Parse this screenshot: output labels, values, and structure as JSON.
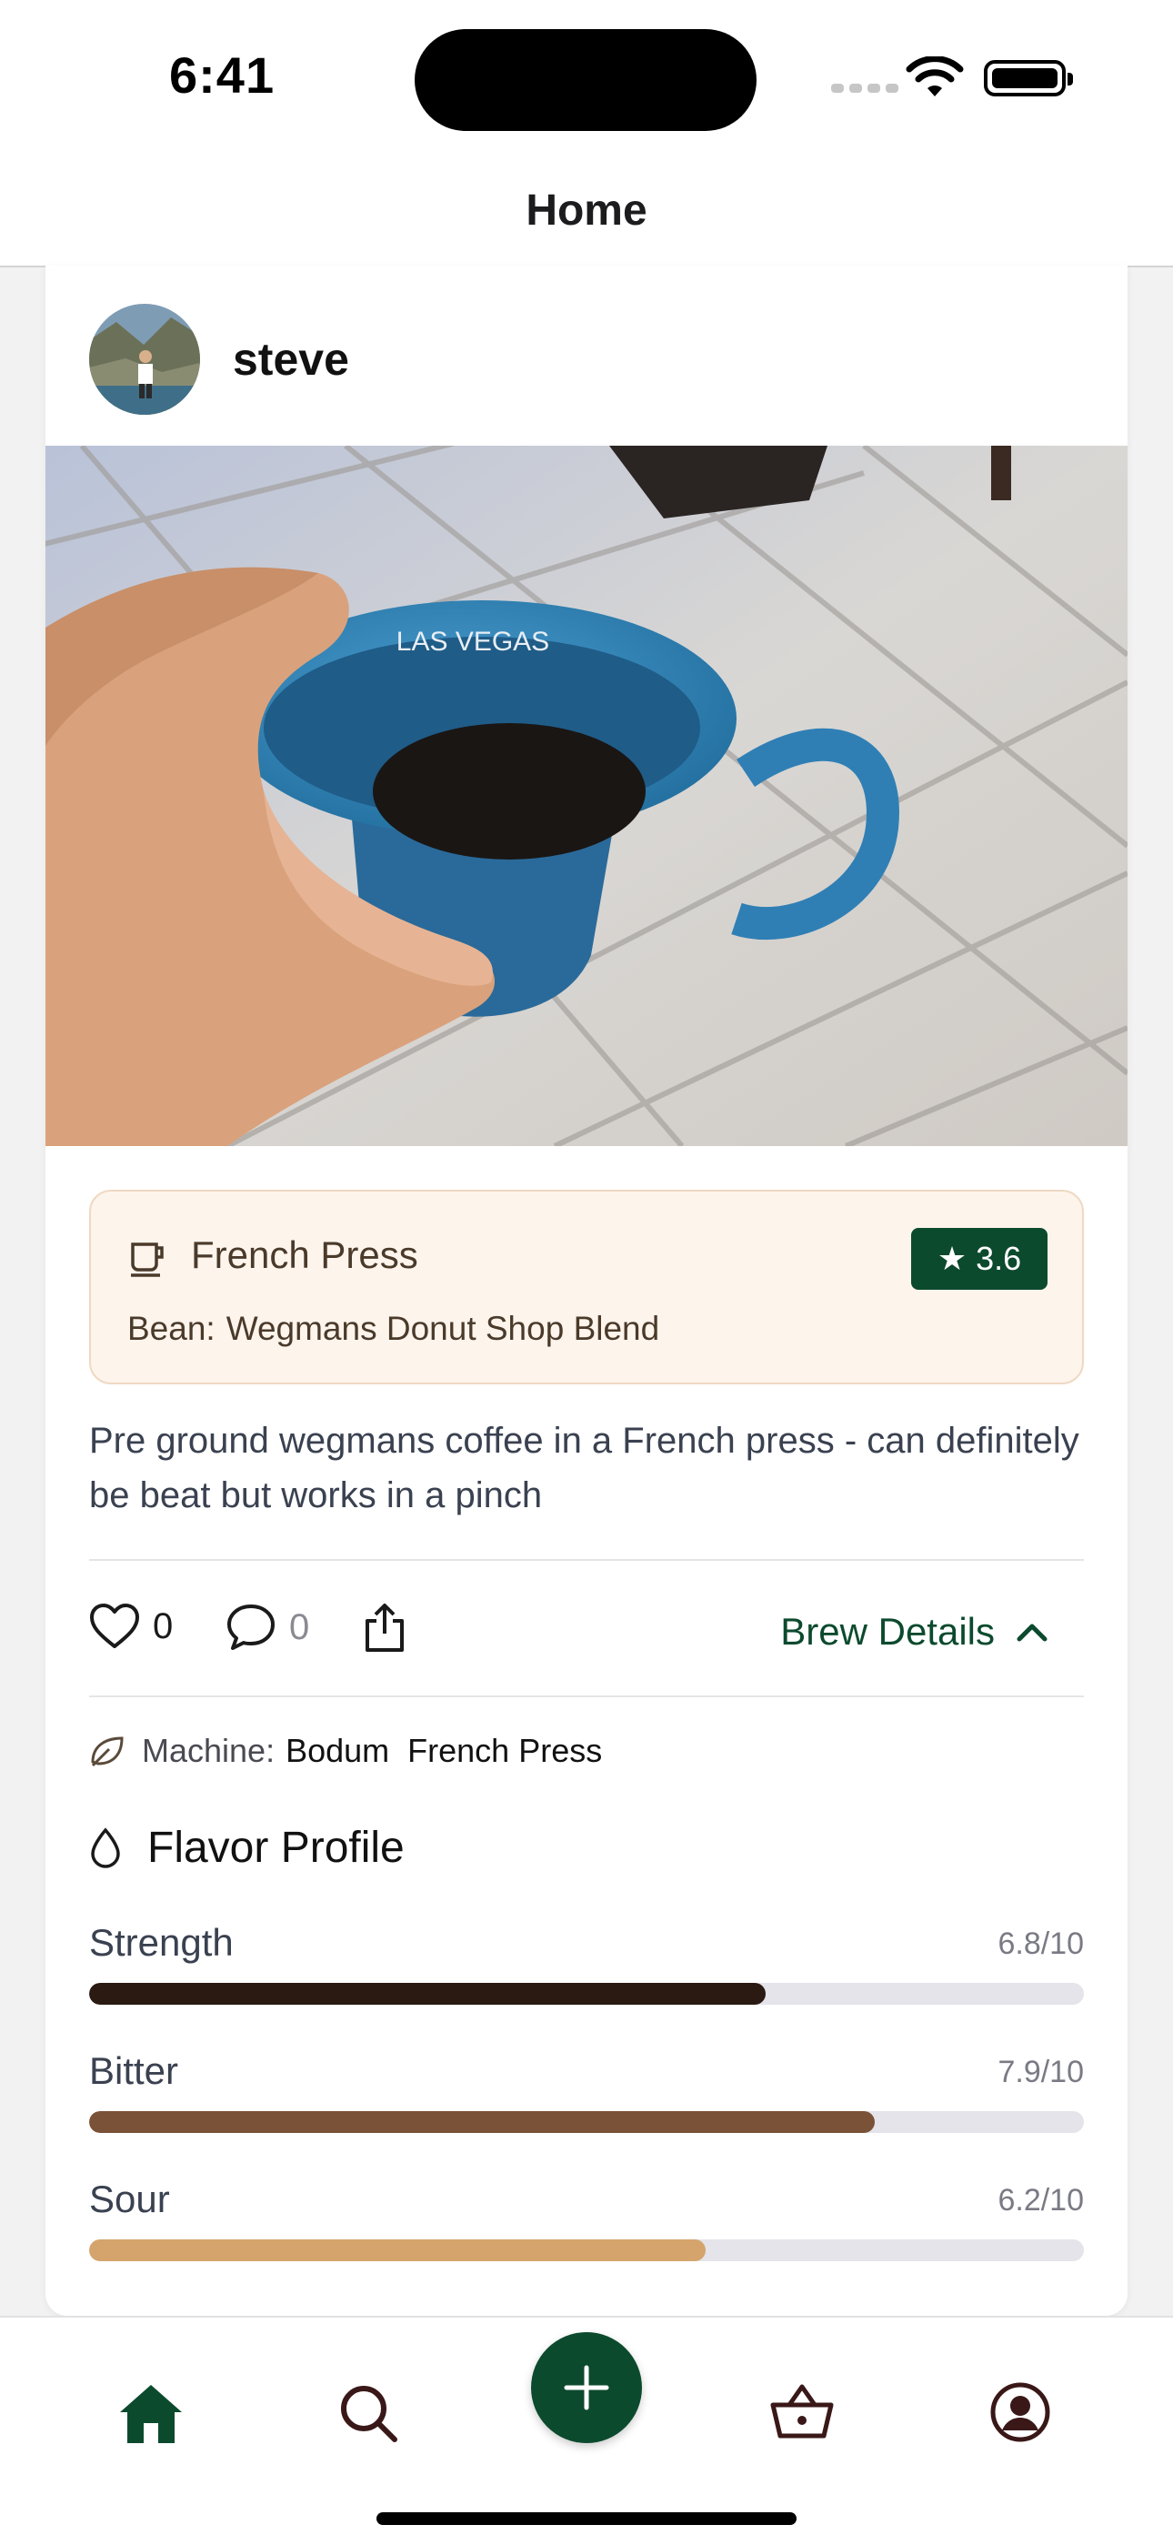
{
  "status_bar": {
    "time": "6:41"
  },
  "nav": {
    "title": "Home"
  },
  "post": {
    "username": "steve",
    "photo_text": "LAS VEGAS",
    "brew": {
      "method": "French Press",
      "bean_label": "Bean:",
      "bean": "Wegmans Donut Shop Blend",
      "rating": "3.6"
    },
    "description": "Pre ground wegmans coffee in a French press - can definitely be beat but works in a pinch",
    "likes": "0",
    "comments": "0",
    "brew_details_label": "Brew Details",
    "machine_label": "Machine:",
    "machine": "Bodum  French Press",
    "flavor_title": "Flavor Profile",
    "flavors": [
      {
        "label": "Strength",
        "value": "6.8/10",
        "fraction": 0.68,
        "color": "#2a1a12"
      },
      {
        "label": "Bitter",
        "value": "7.9/10",
        "fraction": 0.79,
        "color": "#7a5238"
      },
      {
        "label": "Sour",
        "value": "6.2/10",
        "fraction": 0.62,
        "color": "#d4a46c"
      }
    ]
  },
  "tabs": [
    "home-icon",
    "search-icon",
    "add-icon",
    "basket-icon",
    "profile-icon"
  ],
  "colors": {
    "accent": "#0c4a2e",
    "brew_bg": "#fdf4ec"
  }
}
